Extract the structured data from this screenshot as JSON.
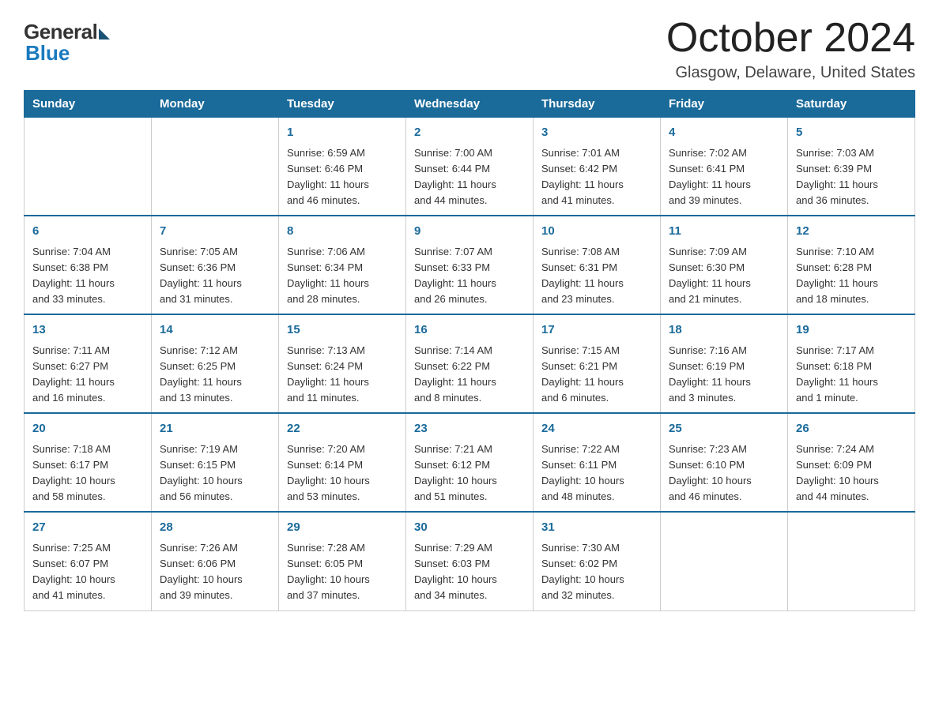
{
  "logo": {
    "general": "General",
    "blue": "Blue"
  },
  "title": "October 2024",
  "location": "Glasgow, Delaware, United States",
  "days_of_week": [
    "Sunday",
    "Monday",
    "Tuesday",
    "Wednesday",
    "Thursday",
    "Friday",
    "Saturday"
  ],
  "weeks": [
    [
      {
        "day": "",
        "info": ""
      },
      {
        "day": "",
        "info": ""
      },
      {
        "day": "1",
        "info": "Sunrise: 6:59 AM\nSunset: 6:46 PM\nDaylight: 11 hours\nand 46 minutes."
      },
      {
        "day": "2",
        "info": "Sunrise: 7:00 AM\nSunset: 6:44 PM\nDaylight: 11 hours\nand 44 minutes."
      },
      {
        "day": "3",
        "info": "Sunrise: 7:01 AM\nSunset: 6:42 PM\nDaylight: 11 hours\nand 41 minutes."
      },
      {
        "day": "4",
        "info": "Sunrise: 7:02 AM\nSunset: 6:41 PM\nDaylight: 11 hours\nand 39 minutes."
      },
      {
        "day": "5",
        "info": "Sunrise: 7:03 AM\nSunset: 6:39 PM\nDaylight: 11 hours\nand 36 minutes."
      }
    ],
    [
      {
        "day": "6",
        "info": "Sunrise: 7:04 AM\nSunset: 6:38 PM\nDaylight: 11 hours\nand 33 minutes."
      },
      {
        "day": "7",
        "info": "Sunrise: 7:05 AM\nSunset: 6:36 PM\nDaylight: 11 hours\nand 31 minutes."
      },
      {
        "day": "8",
        "info": "Sunrise: 7:06 AM\nSunset: 6:34 PM\nDaylight: 11 hours\nand 28 minutes."
      },
      {
        "day": "9",
        "info": "Sunrise: 7:07 AM\nSunset: 6:33 PM\nDaylight: 11 hours\nand 26 minutes."
      },
      {
        "day": "10",
        "info": "Sunrise: 7:08 AM\nSunset: 6:31 PM\nDaylight: 11 hours\nand 23 minutes."
      },
      {
        "day": "11",
        "info": "Sunrise: 7:09 AM\nSunset: 6:30 PM\nDaylight: 11 hours\nand 21 minutes."
      },
      {
        "day": "12",
        "info": "Sunrise: 7:10 AM\nSunset: 6:28 PM\nDaylight: 11 hours\nand 18 minutes."
      }
    ],
    [
      {
        "day": "13",
        "info": "Sunrise: 7:11 AM\nSunset: 6:27 PM\nDaylight: 11 hours\nand 16 minutes."
      },
      {
        "day": "14",
        "info": "Sunrise: 7:12 AM\nSunset: 6:25 PM\nDaylight: 11 hours\nand 13 minutes."
      },
      {
        "day": "15",
        "info": "Sunrise: 7:13 AM\nSunset: 6:24 PM\nDaylight: 11 hours\nand 11 minutes."
      },
      {
        "day": "16",
        "info": "Sunrise: 7:14 AM\nSunset: 6:22 PM\nDaylight: 11 hours\nand 8 minutes."
      },
      {
        "day": "17",
        "info": "Sunrise: 7:15 AM\nSunset: 6:21 PM\nDaylight: 11 hours\nand 6 minutes."
      },
      {
        "day": "18",
        "info": "Sunrise: 7:16 AM\nSunset: 6:19 PM\nDaylight: 11 hours\nand 3 minutes."
      },
      {
        "day": "19",
        "info": "Sunrise: 7:17 AM\nSunset: 6:18 PM\nDaylight: 11 hours\nand 1 minute."
      }
    ],
    [
      {
        "day": "20",
        "info": "Sunrise: 7:18 AM\nSunset: 6:17 PM\nDaylight: 10 hours\nand 58 minutes."
      },
      {
        "day": "21",
        "info": "Sunrise: 7:19 AM\nSunset: 6:15 PM\nDaylight: 10 hours\nand 56 minutes."
      },
      {
        "day": "22",
        "info": "Sunrise: 7:20 AM\nSunset: 6:14 PM\nDaylight: 10 hours\nand 53 minutes."
      },
      {
        "day": "23",
        "info": "Sunrise: 7:21 AM\nSunset: 6:12 PM\nDaylight: 10 hours\nand 51 minutes."
      },
      {
        "day": "24",
        "info": "Sunrise: 7:22 AM\nSunset: 6:11 PM\nDaylight: 10 hours\nand 48 minutes."
      },
      {
        "day": "25",
        "info": "Sunrise: 7:23 AM\nSunset: 6:10 PM\nDaylight: 10 hours\nand 46 minutes."
      },
      {
        "day": "26",
        "info": "Sunrise: 7:24 AM\nSunset: 6:09 PM\nDaylight: 10 hours\nand 44 minutes."
      }
    ],
    [
      {
        "day": "27",
        "info": "Sunrise: 7:25 AM\nSunset: 6:07 PM\nDaylight: 10 hours\nand 41 minutes."
      },
      {
        "day": "28",
        "info": "Sunrise: 7:26 AM\nSunset: 6:06 PM\nDaylight: 10 hours\nand 39 minutes."
      },
      {
        "day": "29",
        "info": "Sunrise: 7:28 AM\nSunset: 6:05 PM\nDaylight: 10 hours\nand 37 minutes."
      },
      {
        "day": "30",
        "info": "Sunrise: 7:29 AM\nSunset: 6:03 PM\nDaylight: 10 hours\nand 34 minutes."
      },
      {
        "day": "31",
        "info": "Sunrise: 7:30 AM\nSunset: 6:02 PM\nDaylight: 10 hours\nand 32 minutes."
      },
      {
        "day": "",
        "info": ""
      },
      {
        "day": "",
        "info": ""
      }
    ]
  ]
}
